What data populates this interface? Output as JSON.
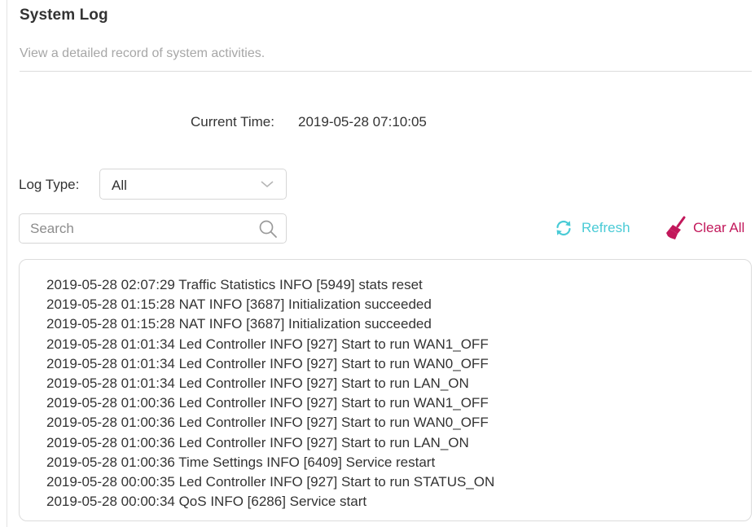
{
  "header": {
    "title": "System Log",
    "subtitle": "View a detailed record of system activities."
  },
  "current_time": {
    "label": "Current Time:",
    "value": "2019-05-28 07:10:05"
  },
  "log_type": {
    "label": "Log Type:",
    "selected": "All"
  },
  "search": {
    "placeholder": "Search",
    "value": ""
  },
  "actions": {
    "refresh_label": "Refresh",
    "clear_all_label": "Clear All"
  },
  "colors": {
    "refresh_accent": "#4acbd6",
    "clear_accent": "#c2185b"
  },
  "icons": {
    "dropdown": "chevron-down-icon",
    "search": "search-icon",
    "refresh": "refresh-icon",
    "clear": "broom-icon"
  },
  "logs": [
    "2019-05-28 02:07:29 Traffic Statistics INFO [5949] stats reset",
    "2019-05-28 01:15:28 NAT INFO [3687] Initialization succeeded",
    "2019-05-28 01:15:28 NAT INFO [3687] Initialization succeeded",
    "2019-05-28 01:01:34 Led Controller INFO [927] Start to run WAN1_OFF",
    "2019-05-28 01:01:34 Led Controller INFO [927] Start to run WAN0_OFF",
    "2019-05-28 01:01:34 Led Controller INFO [927] Start to run LAN_ON",
    "2019-05-28 01:00:36 Led Controller INFO [927] Start to run WAN1_OFF",
    "2019-05-28 01:00:36 Led Controller INFO [927] Start to run WAN0_OFF",
    "2019-05-28 01:00:36 Led Controller INFO [927] Start to run LAN_ON",
    "2019-05-28 01:00:36 Time Settings INFO [6409] Service restart",
    "2019-05-28 00:00:35 Led Controller INFO [927] Start to run STATUS_ON",
    "2019-05-28 00:00:34 QoS INFO [6286] Service start"
  ]
}
